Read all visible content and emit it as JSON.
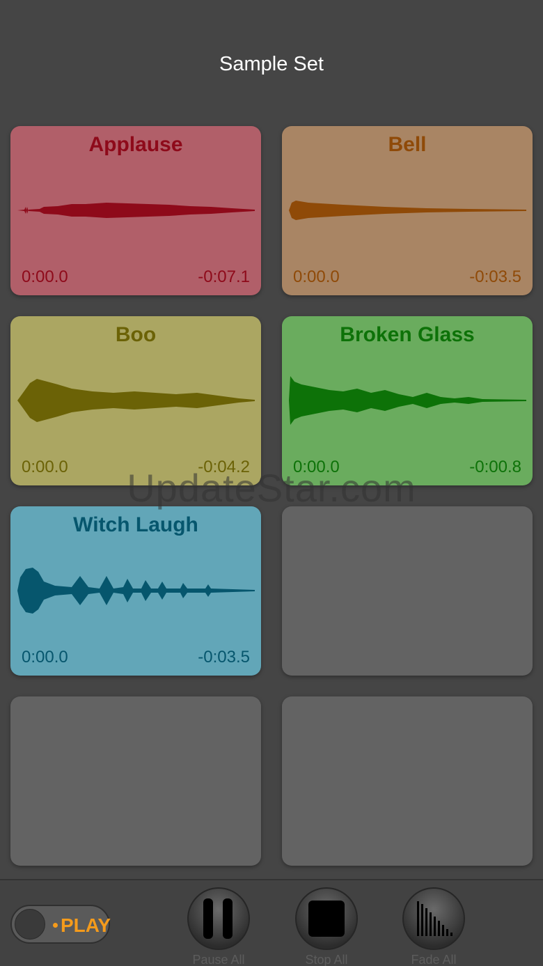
{
  "header": {
    "title": "Sample Set"
  },
  "pads": [
    {
      "name": "Applause",
      "elapsed": "0:00.0",
      "remaining": "-0:07.1",
      "bg": "#b15f69",
      "fg": "#8e0a1a"
    },
    {
      "name": "Bell",
      "elapsed": "0:00.0",
      "remaining": "-0:03.5",
      "bg": "#a98564",
      "fg": "#8f4a08"
    },
    {
      "name": "Boo",
      "elapsed": "0:00.0",
      "remaining": "-0:04.2",
      "bg": "#aba662",
      "fg": "#6b6206"
    },
    {
      "name": "Broken Glass",
      "elapsed": "0:00.0",
      "remaining": "-0:00.8",
      "bg": "#6aac5e",
      "fg": "#0d7208"
    },
    {
      "name": "Witch Laugh",
      "elapsed": "0:00.0",
      "remaining": "-0:03.5",
      "bg": "#62a6b8",
      "fg": "#06566d"
    }
  ],
  "watermark": "UpdateStar.com",
  "controls": {
    "play_label": "PLAY",
    "pause_label": "Pause All",
    "stop_label": "Stop All",
    "fade_label": "Fade All",
    "accent": "#f59b1b"
  }
}
